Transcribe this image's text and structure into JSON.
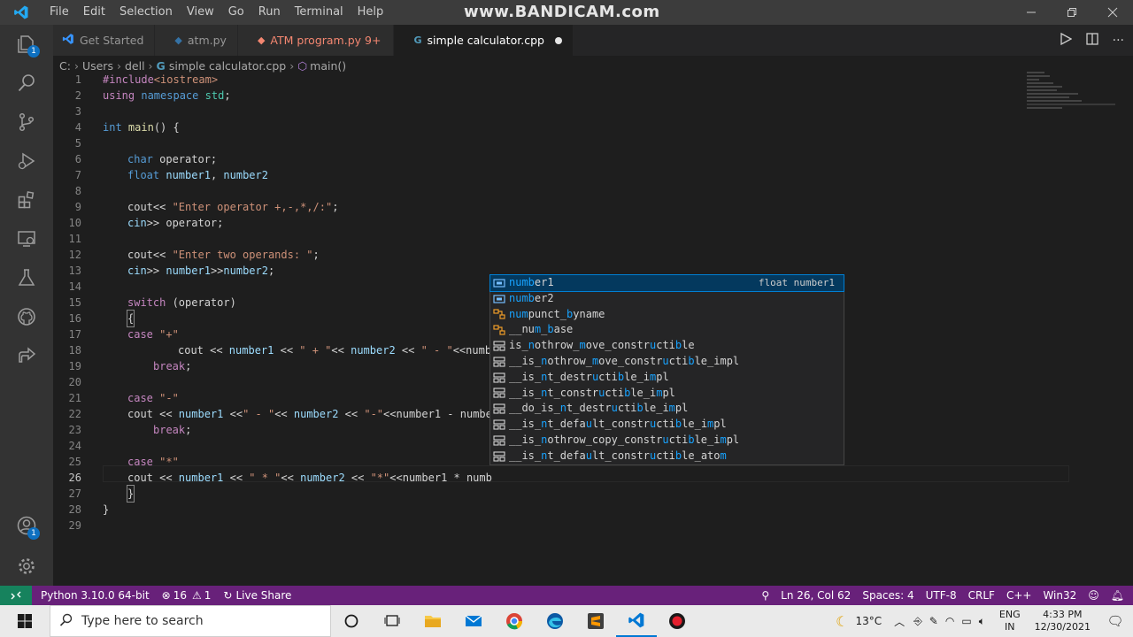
{
  "watermark": "www.BANDICAM.com",
  "menu": [
    "File",
    "Edit",
    "Selection",
    "View",
    "Go",
    "Run",
    "Terminal",
    "Help"
  ],
  "tabs": [
    {
      "label": "Get Started",
      "icon": "vscode-icon",
      "color": "#3794ff"
    },
    {
      "label": "atm.py",
      "icon": "python-icon",
      "color": "#3572A5"
    },
    {
      "label": "ATM program.py",
      "modified": "9+",
      "icon": "python-icon",
      "color": "#f48771"
    },
    {
      "label": "simple calculator.cpp",
      "icon": "cpp-icon",
      "color": "#519aba"
    }
  ],
  "breadcrumb": {
    "parts": [
      "C:",
      "Users",
      "dell"
    ],
    "file": "simple calculator.cpp",
    "symbol": "main()"
  },
  "activity_badges": {
    "explorer": "1",
    "accounts": "1"
  },
  "line_numbers": [
    "1",
    "2",
    "3",
    "4",
    "5",
    "6",
    "7",
    "8",
    "9",
    "10",
    "11",
    "12",
    "13",
    "14",
    "15",
    "16",
    "17",
    "18",
    "19",
    "20",
    "21",
    "22",
    "23",
    "24",
    "25",
    "26",
    "27",
    "28",
    "29"
  ],
  "code": {
    "l1_inc": "#include",
    "l1_hdr": "<iostream>",
    "l2_using": "using",
    "l2_ns_kw": "namespace",
    "l2_std": "std",
    "l2_end": ";",
    "l4_int": "int",
    "l4_main": "main",
    "l4_rest": "() {",
    "l6_char": "char",
    "l6_rest": " operator;",
    "l7_float": "float",
    "l7_n1": "number1",
    "l7_comma": ", ",
    "l7_n2": "number2",
    "l9_cout": "cout<< ",
    "l9_str": "\"Enter operator +,-,*,/:\"",
    "l9_end": ";",
    "l10_cin": "cin",
    "l10_rest": ">> operator;",
    "l12_cout": "cout<< ",
    "l12_str": "\"Enter two operands: \"",
    "l12_end": ";",
    "l13_cin": "cin",
    "l13_a": ">> ",
    "l13_n1": "number1",
    "l13_b": ">>",
    "l13_n2": "number2",
    "l13_end": ";",
    "l15_switch": "switch",
    "l15_rest": " (operator)",
    "l16": "{",
    "l17_case": "case",
    "l17_str": " \"+\"",
    "l18_a": "cout << ",
    "l18_n1": "number1",
    "l18_b": " << ",
    "l18_s1": "\" + \"",
    "l18_c": "<< ",
    "l18_n2": "number2",
    "l18_d": " << ",
    "l18_s2": "\" - \"",
    "l18_e": "<<numb",
    "l19_break": "break",
    "l19_end": ";",
    "l21_case": "case",
    "l21_str": " \"-\"",
    "l22_a": "cout << ",
    "l22_n1": "number1",
    "l22_b": " <<",
    "l22_s1": "\" - \"",
    "l22_c": "<< ",
    "l22_n2": "number2",
    "l22_d": " << ",
    "l22_s2": "\"-\"",
    "l22_e": "<<number1 - numbe",
    "l23_break": "break",
    "l23_end": ";",
    "l25_case": "case",
    "l25_str": " \"*\"",
    "l26_a": "cout << ",
    "l26_n1": "number1",
    "l26_b": " << ",
    "l26_s1": "\" * \"",
    "l26_c": "<< ",
    "l26_n2": "number2",
    "l26_d": " << ",
    "l26_s2": "\"*\"",
    "l26_e": "<<number1 * numb",
    "l27": "}",
    "l28": "}"
  },
  "suggestions": [
    {
      "parts": [
        [
          "numb",
          true
        ],
        [
          "er1",
          false
        ]
      ],
      "kind": "variable",
      "detail": "float number1",
      "selected": true
    },
    {
      "parts": [
        [
          "numb",
          true
        ],
        [
          "er2",
          false
        ]
      ],
      "kind": "variable"
    },
    {
      "parts": [
        [
          "nu",
          true
        ],
        [
          "m",
          true
        ],
        [
          "punct_",
          false
        ],
        [
          "b",
          true
        ],
        [
          "yname",
          false
        ]
      ],
      "kind": "class"
    },
    {
      "parts": [
        [
          "__nu",
          false
        ],
        [
          "m",
          true
        ],
        [
          "_",
          false
        ],
        [
          "b",
          true
        ],
        [
          "ase",
          false
        ]
      ],
      "kind": "class"
    },
    {
      "parts": [
        [
          "is_",
          false
        ],
        [
          "n",
          true
        ],
        [
          "othrow_",
          false
        ],
        [
          "m",
          true
        ],
        [
          "ove_constr",
          false
        ],
        [
          "u",
          true
        ],
        [
          "cti",
          false
        ],
        [
          "b",
          true
        ],
        [
          "le",
          false
        ]
      ],
      "kind": "struct"
    },
    {
      "parts": [
        [
          "__is_",
          false
        ],
        [
          "n",
          true
        ],
        [
          "othrow_",
          false
        ],
        [
          "m",
          true
        ],
        [
          "ove_constr",
          false
        ],
        [
          "u",
          true
        ],
        [
          "cti",
          false
        ],
        [
          "b",
          true
        ],
        [
          "le_impl",
          false
        ]
      ],
      "kind": "struct"
    },
    {
      "parts": [
        [
          "__is_",
          false
        ],
        [
          "n",
          true
        ],
        [
          "t_destr",
          false
        ],
        [
          "u",
          true
        ],
        [
          "cti",
          false
        ],
        [
          "b",
          true
        ],
        [
          "le_i",
          false
        ],
        [
          "m",
          true
        ],
        [
          "pl",
          false
        ]
      ],
      "kind": "struct"
    },
    {
      "parts": [
        [
          "__is_",
          false
        ],
        [
          "n",
          true
        ],
        [
          "t_constr",
          false
        ],
        [
          "u",
          true
        ],
        [
          "cti",
          false
        ],
        [
          "b",
          true
        ],
        [
          "le_i",
          false
        ],
        [
          "m",
          true
        ],
        [
          "pl",
          false
        ]
      ],
      "kind": "struct"
    },
    {
      "parts": [
        [
          "__do_is_",
          false
        ],
        [
          "n",
          true
        ],
        [
          "t_destr",
          false
        ],
        [
          "u",
          true
        ],
        [
          "cti",
          false
        ],
        [
          "b",
          true
        ],
        [
          "le_i",
          false
        ],
        [
          "m",
          true
        ],
        [
          "pl",
          false
        ]
      ],
      "kind": "struct"
    },
    {
      "parts": [
        [
          "__is_",
          false
        ],
        [
          "n",
          true
        ],
        [
          "t_defa",
          false
        ],
        [
          "u",
          true
        ],
        [
          "lt_constr",
          false
        ],
        [
          "u",
          true
        ],
        [
          "cti",
          false
        ],
        [
          "b",
          true
        ],
        [
          "le_i",
          false
        ],
        [
          "m",
          true
        ],
        [
          "pl",
          false
        ]
      ],
      "kind": "struct"
    },
    {
      "parts": [
        [
          "__is_",
          false
        ],
        [
          "n",
          true
        ],
        [
          "othrow_copy_constr",
          false
        ],
        [
          "u",
          true
        ],
        [
          "cti",
          false
        ],
        [
          "b",
          true
        ],
        [
          "le_i",
          false
        ],
        [
          "m",
          true
        ],
        [
          "pl",
          false
        ]
      ],
      "kind": "struct"
    },
    {
      "parts": [
        [
          "__is_",
          false
        ],
        [
          "n",
          true
        ],
        [
          "t_defa",
          false
        ],
        [
          "u",
          true
        ],
        [
          "lt_constr",
          false
        ],
        [
          "u",
          true
        ],
        [
          "cti",
          false
        ],
        [
          "b",
          true
        ],
        [
          "le_ato",
          false
        ],
        [
          "m",
          true
        ]
      ],
      "kind": "struct"
    }
  ],
  "status": {
    "python": "Python 3.10.0 64-bit",
    "errors": "16",
    "warnings": "1",
    "live_share": "Live Share",
    "position": "Ln 26, Col 62",
    "spaces": "Spaces: 4",
    "encoding": "UTF-8",
    "eol": "CRLF",
    "language": "C++",
    "platform": "Win32"
  },
  "taskbar": {
    "search_placeholder": "Type here to search",
    "temperature": "13°C",
    "lang1": "ENG",
    "lang2": "IN",
    "time": "4:33 PM",
    "date": "12/30/2021"
  }
}
